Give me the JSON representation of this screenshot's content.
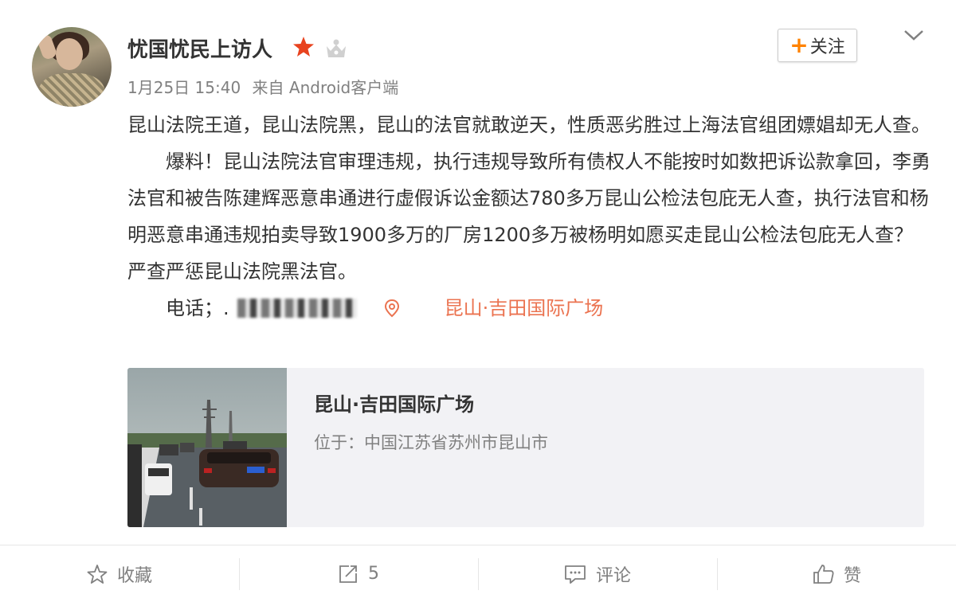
{
  "user": {
    "name": "忧国忧民上访人",
    "badges": [
      "star-icon",
      "crown-icon"
    ]
  },
  "follow_button": {
    "plus": "+",
    "label": "关注"
  },
  "meta": {
    "time": "1月25日 15:40",
    "source": "来自 Android客户端"
  },
  "post": {
    "paragraph1": "昆山法院王道，昆山法院黑，昆山的法官就敢逆天，性质恶劣胜过上海法官组团嫖娼却无人查。",
    "paragraph2": "爆料！昆山法院法官审理违规，执行违规导致所有债权人不能按时如数把诉讼款拿回，李勇法官和被告陈建辉恶意串通进行虚假诉讼金额达780多万昆山公检法包庇无人查，执行法官和杨明恶意串通违规拍卖导致1900多万的厂房1200多万被杨明如愿买走昆山公检法包庇无人查？严查严惩昆山法院黑法官。",
    "phone_label": "电话；.",
    "location": "昆山·吉田国际广场"
  },
  "location_card": {
    "title": "昆山·吉田国际广场",
    "address": "位于：中国江苏省苏州市昆山市"
  },
  "actions": {
    "favorite": {
      "label": "收藏",
      "icon": "star-outline-icon"
    },
    "repost": {
      "label": "5",
      "icon": "share-icon"
    },
    "comment": {
      "label": "评论",
      "icon": "comment-icon"
    },
    "like": {
      "label": "赞",
      "icon": "thumbs-up-icon"
    }
  },
  "colors": {
    "accent": "#ff8200",
    "link": "#eb7350",
    "muted": "#808080",
    "text": "#333333",
    "card_bg": "#f2f2f5"
  }
}
